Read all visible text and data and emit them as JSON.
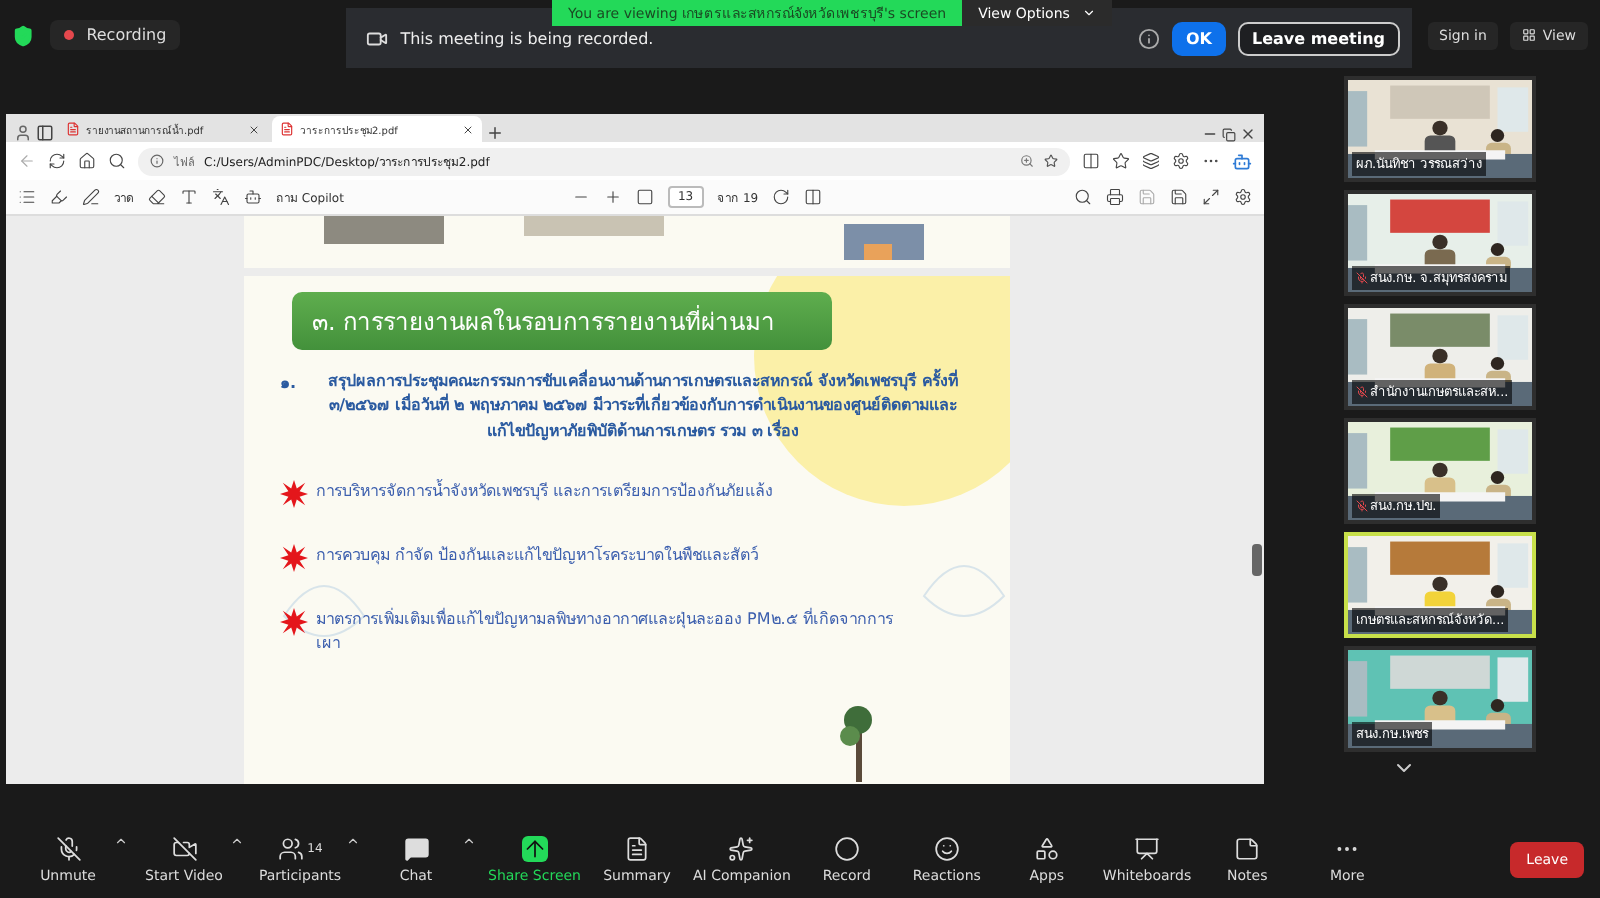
{
  "meeting_bar": {
    "status": "Recording",
    "notice": "This meeting is being recorded.",
    "ok": "OK",
    "leave": "Leave meeting",
    "sign_in": "Sign in",
    "view": "View"
  },
  "share_banner": {
    "text": "You are viewing เกษตรและสหกรณ์จังหวัดเพชรบุรี's screen",
    "options": "View Options"
  },
  "browser": {
    "tabs": [
      {
        "label": "รายงานสถานการณ์น้ำ.pdf",
        "selected": false
      },
      {
        "label": "วาระการประชุม2.pdf",
        "selected": true
      }
    ],
    "address_label": "ไฟล์",
    "url": "C:/Users/AdminPDC/Desktop/วาระการประชุม2.pdf",
    "pdf_toolbar": {
      "draw": "วาด",
      "copilot": "ถาม Copilot",
      "page": "13",
      "page_total": "จาก 19"
    }
  },
  "slide": {
    "heading": "๓. การรายงานผลในรอบการรายงานที่ผ่านมา",
    "number": "๑.",
    "paragraph": "สรุปผลการประชุมคณะกรรมการขับเคลื่อนงานด้านการเกษตรและสหกรณ์ จังหวัดเพชรบุรี ครั้งที่ ๓/๒๕๖๗ เมื่อวันที่ ๒ พฤษภาคม ๒๕๖๗ มีวาระที่เกี่ยวข้องกับการดำเนินงานของศูนย์ติดตามและแก้ไขปัญหาภัยพิบัติด้านการเกษตร รวม ๓ เรื่อง",
    "bullets": [
      "การบริหารจัดการน้ำจังหวัดเพชรบุรี และการเตรียมการป้องกันภัยแล้ง",
      "การควบคุม กำจัด ป้องกันและแก้ไขปัญหาโรคระบาดในพืชและสัตว์",
      "มาตรการเพิ่มเติมเพื่อแก้ไขปัญหามลพิษทางอากาศและฝุ่นละออง PM๒.๕ ที่เกิดจากการเผา"
    ]
  },
  "participants": [
    {
      "name": "ผภ.นันทิชา วรรณสว่าง",
      "muted": false,
      "active": false
    },
    {
      "name": "สนง.กษ. จ.สมุทรสงคราม",
      "muted": true,
      "active": false
    },
    {
      "name": "สำนักงานเกษตรและสห...",
      "muted": true,
      "active": false
    },
    {
      "name": "สนง.กษ.ปข.",
      "muted": true,
      "active": false
    },
    {
      "name": "เกษตรและสหกรณ์จังหวัด...",
      "muted": false,
      "active": true
    },
    {
      "name": "สนง.กษ.เพชร",
      "muted": false,
      "active": false
    }
  ],
  "toolbar": [
    {
      "kind": "audio",
      "label": "Unmute",
      "muted": true
    },
    {
      "kind": "video",
      "label": "Start Video",
      "muted": true
    },
    {
      "kind": "participants",
      "label": "Participants",
      "count": "14"
    },
    {
      "kind": "chat",
      "label": "Chat"
    },
    {
      "kind": "share",
      "label": "Share Screen"
    },
    {
      "kind": "summary",
      "label": "Summary"
    },
    {
      "kind": "ai",
      "label": "AI Companion"
    },
    {
      "kind": "record",
      "label": "Record"
    },
    {
      "kind": "reactions",
      "label": "Reactions"
    },
    {
      "kind": "apps",
      "label": "Apps"
    },
    {
      "kind": "whiteboards",
      "label": "Whiteboards"
    },
    {
      "kind": "notes",
      "label": "Notes"
    },
    {
      "kind": "more",
      "label": "More"
    }
  ],
  "leave": "Leave"
}
